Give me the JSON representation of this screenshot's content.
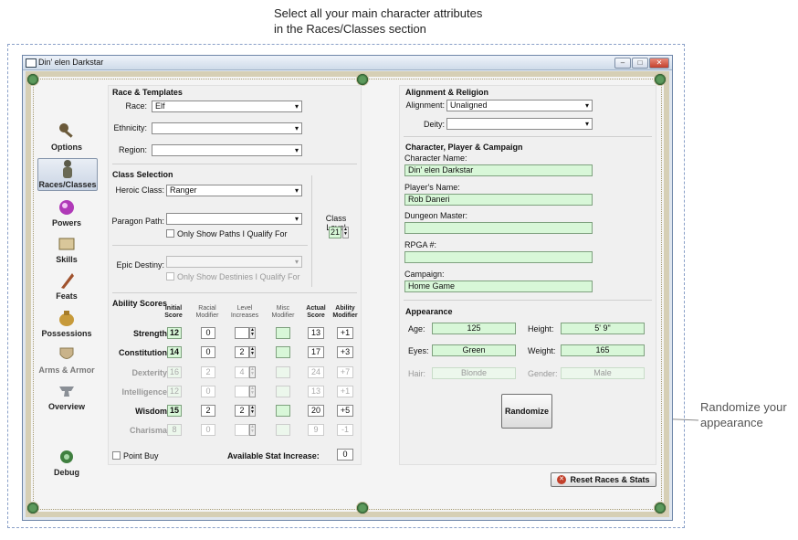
{
  "annotations": {
    "top_line1": "Select all your main character attributes",
    "top_line2": "in the Races/Classes section",
    "side_line1": "Randomize your",
    "side_line2": "appearance"
  },
  "window": {
    "title": "Din' elen Darkstar"
  },
  "nav": [
    {
      "label": "Options",
      "icon": "key-icon"
    },
    {
      "label": "Races/Classes",
      "icon": "figure-icon"
    },
    {
      "label": "Powers",
      "icon": "orb-icon"
    },
    {
      "label": "Skills",
      "icon": "scroll-icon"
    },
    {
      "label": "Feats",
      "icon": "quill-icon"
    },
    {
      "label": "Possessions",
      "icon": "bag-icon"
    },
    {
      "label": "Arms & Armor",
      "icon": "shield-icon"
    },
    {
      "label": "Overview",
      "icon": "anvil-icon"
    },
    {
      "label": "Debug",
      "icon": "debug-icon"
    }
  ],
  "race": {
    "section": "Race & Templates",
    "race_label": "Race:",
    "race_value": "Elf",
    "ethnicity_label": "Ethnicity:",
    "ethnicity_value": "",
    "region_label": "Region:",
    "region_value": ""
  },
  "class": {
    "section": "Class Selection",
    "heroic_label": "Heroic Class:",
    "heroic_value": "Ranger",
    "paragon_label": "Paragon Path:",
    "paragon_value": "",
    "paragon_check": "Only Show Paths I Qualify For",
    "epic_label": "Epic Destiny:",
    "epic_value": "",
    "epic_check": "Only Show Destinies I Qualify For",
    "level_label": "Class Level",
    "level_value": "21"
  },
  "ability": {
    "section": "Ability Scores",
    "headers": {
      "initial": "Initial Score",
      "racial": "Racial Modifier",
      "level": "Level Increases",
      "misc": "Misc Modifier",
      "actual": "Actual Score",
      "mod": "Ability Modifier"
    },
    "rows": [
      {
        "name": "Strength",
        "initial": "12",
        "racial": "0",
        "level": "",
        "actual": "13",
        "mod": "+1",
        "dim": false
      },
      {
        "name": "Constitution",
        "initial": "14",
        "racial": "0",
        "level": "2",
        "actual": "17",
        "mod": "+3",
        "dim": false
      },
      {
        "name": "Dexterity",
        "initial": "16",
        "racial": "2",
        "level": "4",
        "actual": "24",
        "mod": "+7",
        "dim": true
      },
      {
        "name": "Intelligence",
        "initial": "12",
        "racial": "0",
        "level": "",
        "actual": "13",
        "mod": "+1",
        "dim": true
      },
      {
        "name": "Wisdom",
        "initial": "15",
        "racial": "2",
        "level": "2",
        "actual": "20",
        "mod": "+5",
        "dim": false
      },
      {
        "name": "Charisma",
        "initial": "8",
        "racial": "0",
        "level": "",
        "actual": "9",
        "mod": "-1",
        "dim": true
      }
    ],
    "point_buy": "Point Buy",
    "available_label": "Available Stat Increase:",
    "available_value": "0"
  },
  "alignment": {
    "section": "Alignment & Religion",
    "alignment_label": "Alignment:",
    "alignment_value": "Unaligned",
    "deity_label": "Deity:",
    "deity_value": ""
  },
  "character": {
    "section": "Character, Player & Campaign",
    "name_label": "Character Name:",
    "name_value": "Din' elen Darkstar",
    "player_label": "Player's Name:",
    "player_value": "Rob Daneri",
    "dm_label": "Dungeon Master:",
    "dm_value": "",
    "rpga_label": "RPGA #:",
    "rpga_value": "",
    "campaign_label": "Campaign:",
    "campaign_value": "Home Game"
  },
  "appearance": {
    "section": "Appearance",
    "age_label": "Age:",
    "age_value": "125",
    "height_label": "Height:",
    "height_value": "5' 9\"",
    "eyes_label": "Eyes:",
    "eyes_value": "Green",
    "weight_label": "Weight:",
    "weight_value": "165",
    "hair_label": "Hair:",
    "hair_value": "Blonde",
    "gender_label": "Gender:",
    "gender_value": "Male",
    "randomize": "Randomize"
  },
  "reset_button": "Reset Races & Stats",
  "colors": {
    "field_green": "#d8f7d8",
    "accent_red": "#c2402b"
  }
}
